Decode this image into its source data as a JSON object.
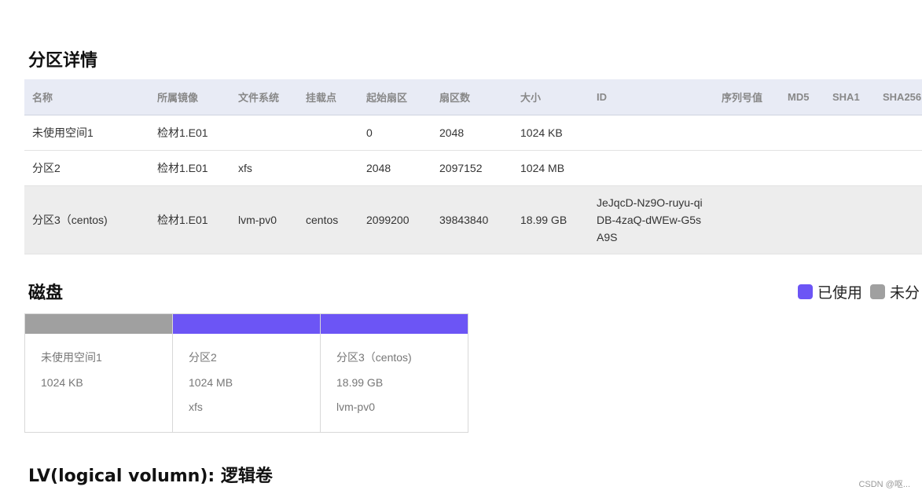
{
  "partitions_section": {
    "title": "分区详情",
    "columns": [
      "名称",
      "所属镜像",
      "文件系统",
      "挂载点",
      "起始扇区",
      "扇区数",
      "大小",
      "ID",
      "序列号值",
      "MD5",
      "SHA1",
      "SHA256"
    ],
    "rows": [
      {
        "name": "未使用空间1",
        "image": "检材1.E01",
        "fs": "",
        "mount": "",
        "start": "0",
        "sectors": "2048",
        "size": "1024 KB",
        "id": "",
        "serial": "",
        "md5": "",
        "sha1": "",
        "sha256": ""
      },
      {
        "name": "分区2",
        "image": "检材1.E01",
        "fs": "xfs",
        "mount": "",
        "start": "2048",
        "sectors": "2097152",
        "size": "1024 MB",
        "id": "",
        "serial": "",
        "md5": "",
        "sha1": "",
        "sha256": ""
      },
      {
        "name": "分区3（centos)",
        "image": "检材1.E01",
        "fs": "lvm-pv0",
        "mount": "centos",
        "start": "2099200",
        "sectors": "39843840",
        "size": "18.99 GB",
        "id": "JeJqcD-Nz9O-ruyu-qiDB-4zaQ-dWEw-G5sA9S",
        "serial": "",
        "md5": "",
        "sha1": "",
        "sha256": ""
      }
    ]
  },
  "disk_section": {
    "title": "磁盘",
    "legend": [
      {
        "label": "已使用",
        "color": "#6c55f5"
      },
      {
        "label": "未分",
        "color": "#a0a0a0"
      }
    ],
    "blocks": [
      {
        "name": "未使用空间1",
        "size": "1024 KB",
        "fs": "",
        "color": "#a0a0a0"
      },
      {
        "name": "分区2",
        "size": "1024 MB",
        "fs": "xfs",
        "color": "#6c55f5"
      },
      {
        "name": "分区3（centos)",
        "size": "18.99 GB",
        "fs": "lvm-pv0",
        "color": "#6c55f5"
      }
    ]
  },
  "lv_section": {
    "title": "LV(logical volumn): 逻辑卷"
  },
  "watermark": "CSDN @呕..."
}
